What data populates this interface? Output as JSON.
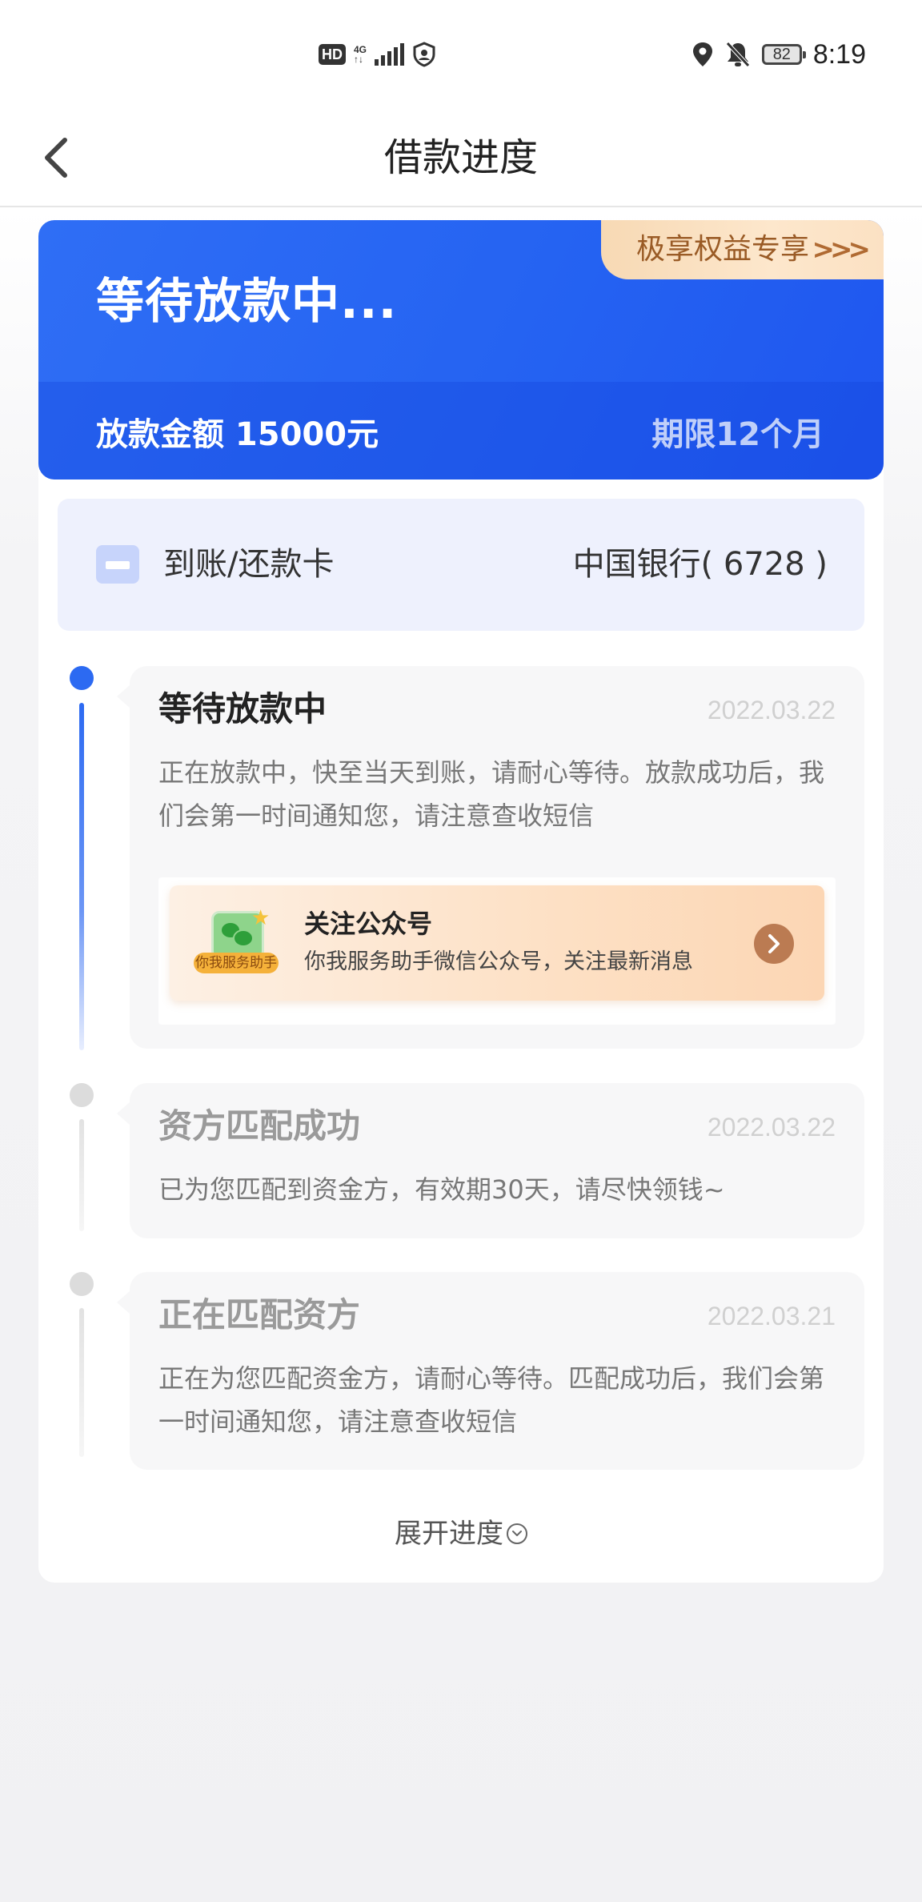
{
  "status_bar": {
    "hd_label": "HD",
    "network_label": "4G",
    "network_sub": "↑↓",
    "battery": "82",
    "time": "8:19"
  },
  "nav": {
    "title": "借款进度",
    "back_icon": "chevron-left-icon"
  },
  "hero": {
    "title": "等待放款中...",
    "perk_label": "极享权益专享",
    "perk_arrows": ">>>",
    "amount": "放款金额 15000元",
    "term": "期限12个月",
    "colors": {
      "primary": "#2563f2",
      "perk_text": "#9a5b26"
    }
  },
  "bank": {
    "label": "到账/还款卡",
    "value": "中国银行( 6728 )",
    "icon": "card-icon"
  },
  "steps": [
    {
      "title": "等待放款中",
      "date": "2022.03.22",
      "desc": "正在放款中，快至当天到账，请耐心等待。放款成功后，我们会第一时间通知您，请注意查收短信",
      "active": true
    },
    {
      "title": "资方匹配成功",
      "date": "2022.03.22",
      "desc": "已为您匹配到资金方，有效期30天，请尽快领钱~",
      "active": false
    },
    {
      "title": "正在匹配资方",
      "date": "2022.03.21",
      "desc": "正在为您匹配资金方，请耐心等待。匹配成功后，我们会第一时间通知您，请注意查收短信",
      "active": false
    }
  ],
  "promo": {
    "badge": "你我服务助手",
    "title": "关注公众号",
    "subtitle": "你我服务助手微信公众号，关注最新消息",
    "icon": "wechat-icon",
    "go_icon": "chevron-right-icon"
  },
  "expand": {
    "label": "展开进度",
    "icon": "chevron-down-circle-icon"
  }
}
